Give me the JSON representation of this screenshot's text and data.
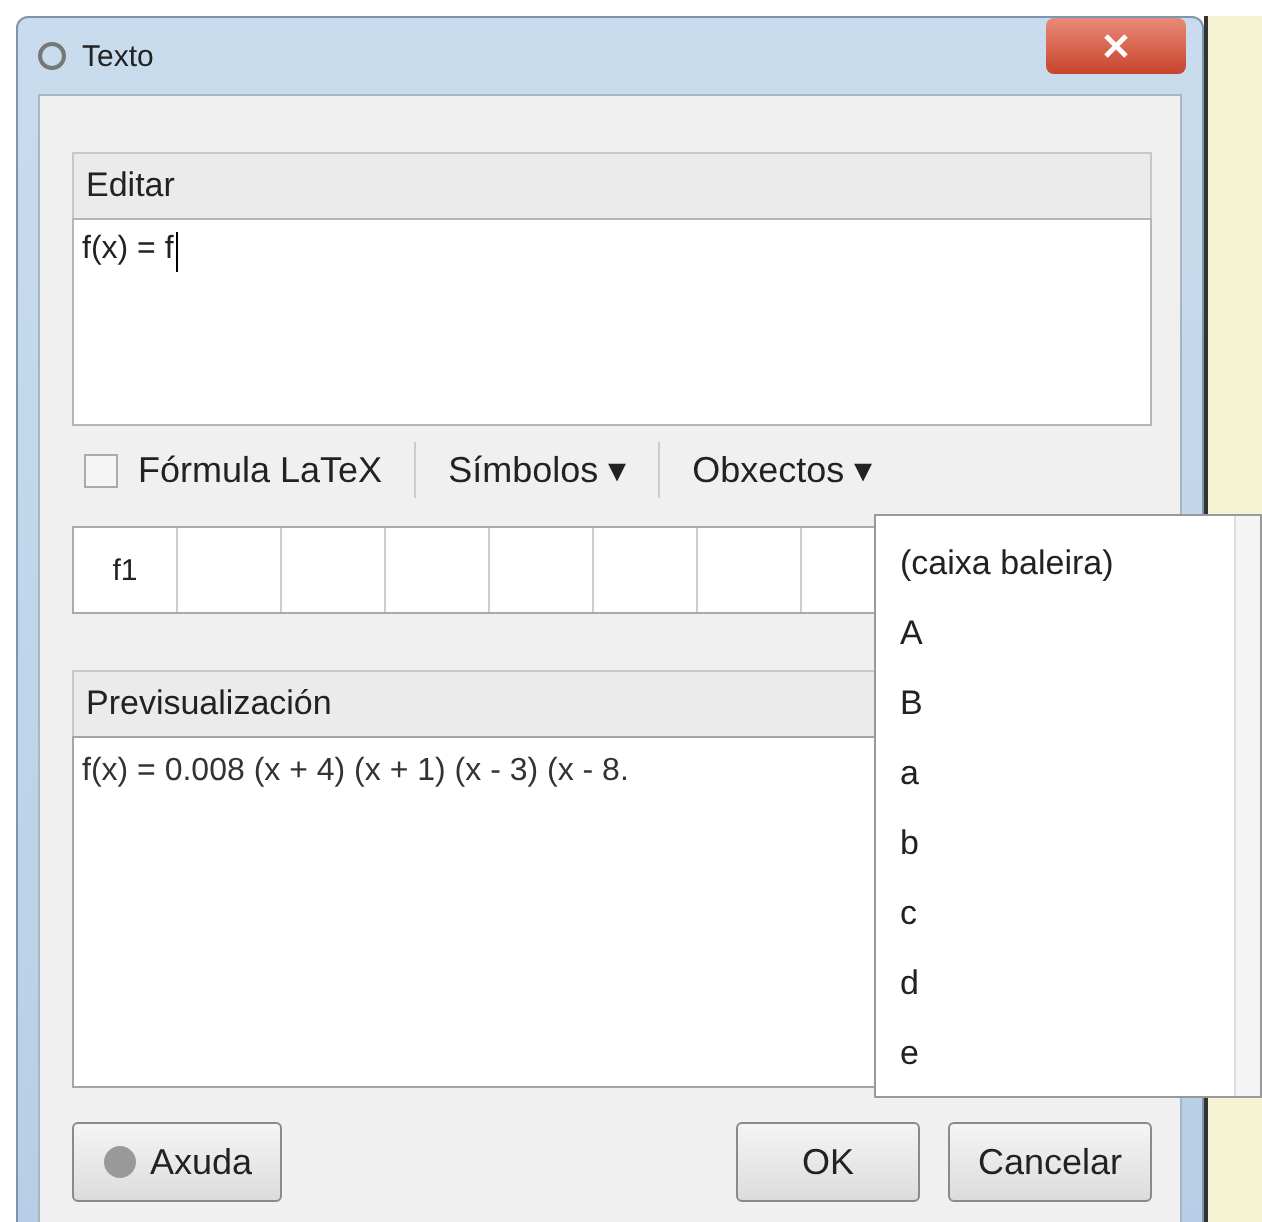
{
  "window": {
    "title": "Texto"
  },
  "edit": {
    "label": "Editar",
    "value": "f(x) = f"
  },
  "toolbar": {
    "latex": {
      "label": "Fórmula LaTeX",
      "checked": false
    },
    "menus": [
      "Símbolos ▾",
      "Obxectos ▾"
    ]
  },
  "cells": [
    "f1"
  ],
  "preview": {
    "label": "Previsualización",
    "text": "f(x) = 0.008 (x + 4) (x + 1) (x - 3) (x - 8."
  },
  "dropdown": {
    "items": [
      "(caixa baleira)",
      "A",
      "B",
      "a",
      "b",
      "c",
      "d",
      "e"
    ]
  },
  "buttons": {
    "help": "Axuda",
    "ok": "OK",
    "cancel": "Cancelar"
  }
}
